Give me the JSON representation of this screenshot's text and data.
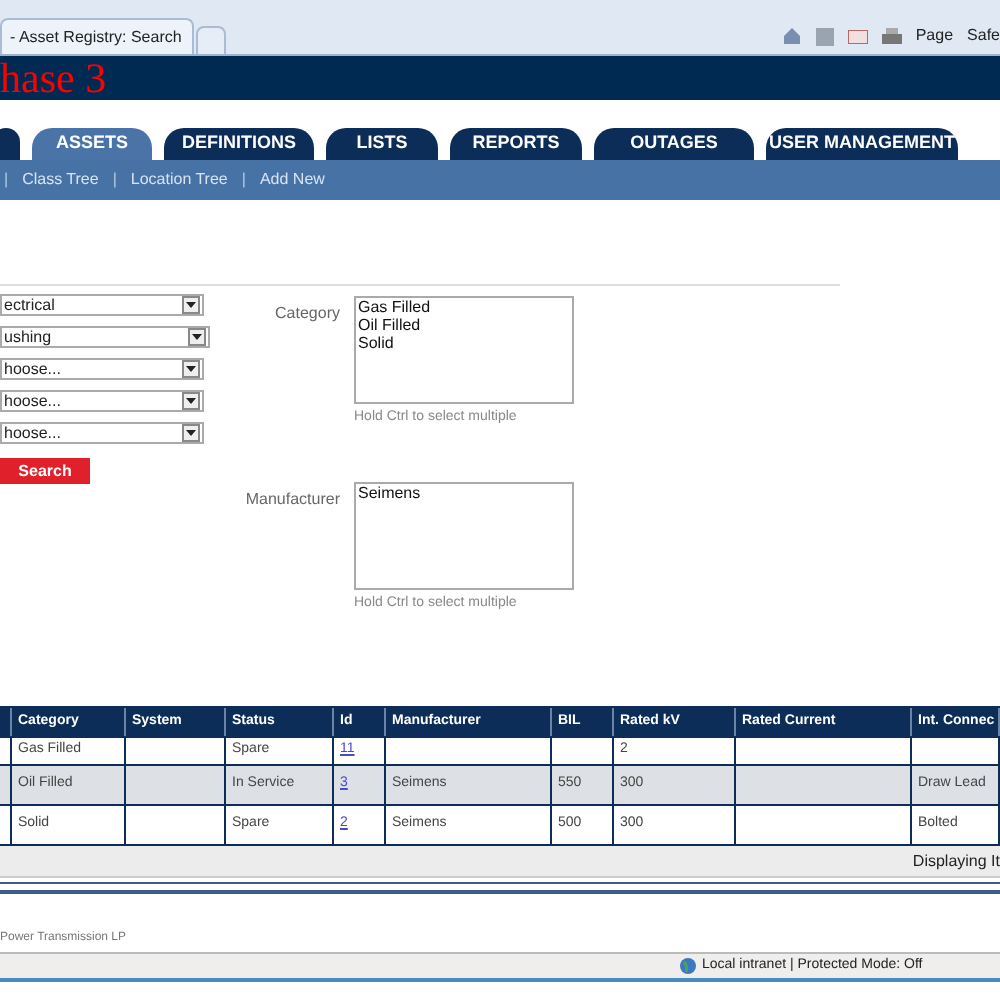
{
  "browser": {
    "tab_title": "- Asset Registry: Search",
    "menus": [
      "Page",
      "Safe"
    ]
  },
  "header": {
    "title": "hase 3"
  },
  "tabs": [
    {
      "selected": false
    },
    {
      "label": "ASSETS",
      "selected": true
    },
    {
      "label": "DEFINITIONS",
      "selected": false
    },
    {
      "label": "LISTS",
      "selected": false
    },
    {
      "label": "REPORTS",
      "selected": false
    },
    {
      "label": "OUTAGES",
      "selected": false
    },
    {
      "label": "USER MANAGEMENT",
      "selected": false
    }
  ],
  "sub_nav": {
    "separator": "|",
    "links": [
      "Class Tree",
      "Location Tree",
      "Add New"
    ]
  },
  "filters": [
    "ectrical",
    "ushing",
    "hoose...",
    "hoose...",
    "hoose..."
  ],
  "search_button": "Search",
  "lists": [
    {
      "label": "Category",
      "options": [
        "Gas Filled",
        "Oil Filled",
        "Solid"
      ],
      "hint": "Hold Ctrl to select multiple"
    },
    {
      "label": "Manufacturer",
      "options": [
        "Seimens"
      ],
      "hint": "Hold Ctrl to select multiple"
    }
  ],
  "table": {
    "columns": [
      "Category",
      "System",
      "Status",
      "Id",
      "Manufacturer",
      "BIL",
      "Rated kV",
      "Rated Current",
      "Int. Connec"
    ],
    "rows": [
      [
        "Gas Filled",
        "",
        "Spare",
        "11",
        "",
        "",
        "2",
        "",
        ""
      ],
      [
        "Oil Filled",
        "",
        "In Service",
        "3",
        "Seimens",
        "550",
        "300",
        "",
        "Draw Lead"
      ],
      [
        "Solid",
        "",
        "Spare",
        "2",
        "Seimens",
        "500",
        "300",
        "",
        "Bolted"
      ]
    ]
  },
  "pager": {
    "text": "Displaying It"
  },
  "footer": {
    "text": "Power Transmission LP"
  },
  "status_bar": {
    "zone": "Local intranet | Protected Mode: Off"
  }
}
